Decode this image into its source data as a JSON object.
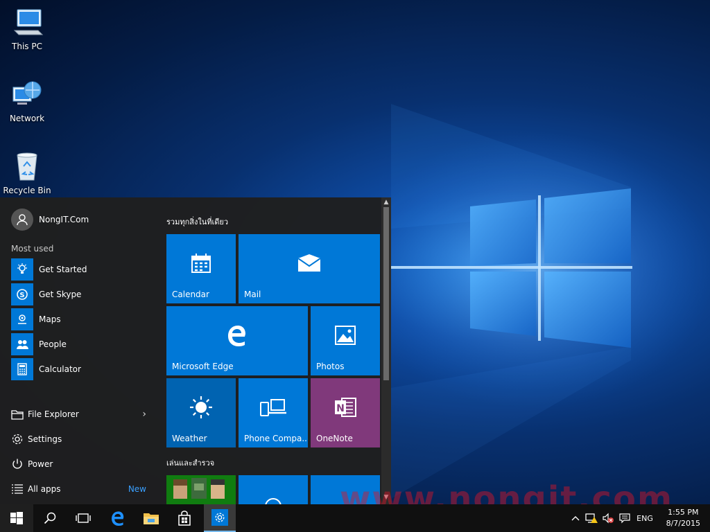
{
  "desktop": {
    "icons": [
      {
        "label": "This PC"
      },
      {
        "label": "Network"
      },
      {
        "label": "Recycle Bin"
      }
    ]
  },
  "start_menu": {
    "user_name": "NongIT.Com",
    "most_used_label": "Most used",
    "most_used": [
      {
        "label": "Get Started",
        "icon": "lightbulb-icon"
      },
      {
        "label": "Get Skype",
        "icon": "skype-icon"
      },
      {
        "label": "Maps",
        "icon": "maps-icon"
      },
      {
        "label": "People",
        "icon": "people-icon"
      },
      {
        "label": "Calculator",
        "icon": "calculator-icon"
      }
    ],
    "system": {
      "file_explorer": "File Explorer",
      "settings": "Settings",
      "power": "Power",
      "all_apps": "All apps",
      "new_badge": "New"
    },
    "groups": [
      {
        "label": "รวมทุกสิ่งในที่เดียว"
      },
      {
        "label": "เล่นและสำรวจ"
      }
    ],
    "tiles": {
      "calendar": "Calendar",
      "mail": "Mail",
      "edge": "Microsoft Edge",
      "photos": "Photos",
      "weather": "Weather",
      "phone": "Phone Compa...",
      "onenote": "OneNote"
    }
  },
  "colors": {
    "accent": "#0078d7",
    "onenote": "#80397b",
    "xbox": "#107c10",
    "start_bg": "#1f1f1f"
  },
  "taskbar": {
    "language": "ENG",
    "time": "1:55 PM",
    "date": "8/7/2015"
  },
  "watermark": "www.nongit.com"
}
